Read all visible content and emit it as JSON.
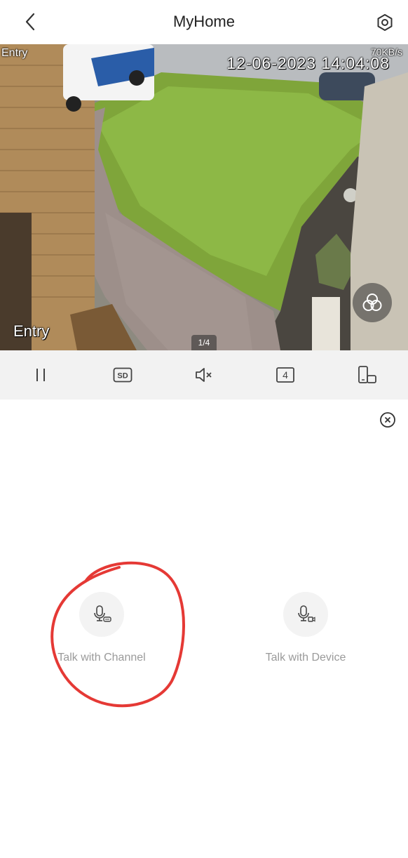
{
  "header": {
    "title": "MyHome"
  },
  "video": {
    "channel_name_top": "Entry",
    "bitrate": "70KB/s",
    "timestamp": "12-06-2023 14:04:08",
    "channel_name_bottom": "Entry",
    "page_indicator": "1/4"
  },
  "toolbar": {
    "pause_icon": "pause-icon",
    "quality_label": "SD",
    "mute_icon": "speaker-muted-icon",
    "split_count": "4",
    "rotate_icon": "phone-rotate-icon"
  },
  "talk_panel": {
    "options": [
      {
        "label": "Talk with Channel",
        "icon": "mic-channel-icon"
      },
      {
        "label": "Talk with Device",
        "icon": "mic-device-icon"
      }
    ]
  },
  "colors": {
    "annotation_red": "#e53935",
    "toolbar_bg": "#f2f2f2",
    "label_gray": "#9a9a9a"
  }
}
